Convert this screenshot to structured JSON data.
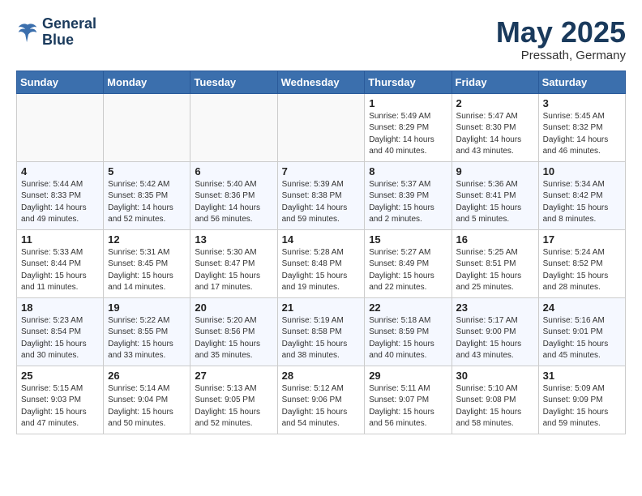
{
  "header": {
    "logo_line1": "General",
    "logo_line2": "Blue",
    "month": "May 2025",
    "location": "Pressath, Germany"
  },
  "weekdays": [
    "Sunday",
    "Monday",
    "Tuesday",
    "Wednesday",
    "Thursday",
    "Friday",
    "Saturday"
  ],
  "weeks": [
    [
      {
        "day": "",
        "info": ""
      },
      {
        "day": "",
        "info": ""
      },
      {
        "day": "",
        "info": ""
      },
      {
        "day": "",
        "info": ""
      },
      {
        "day": "1",
        "info": "Sunrise: 5:49 AM\nSunset: 8:29 PM\nDaylight: 14 hours\nand 40 minutes."
      },
      {
        "day": "2",
        "info": "Sunrise: 5:47 AM\nSunset: 8:30 PM\nDaylight: 14 hours\nand 43 minutes."
      },
      {
        "day": "3",
        "info": "Sunrise: 5:45 AM\nSunset: 8:32 PM\nDaylight: 14 hours\nand 46 minutes."
      }
    ],
    [
      {
        "day": "4",
        "info": "Sunrise: 5:44 AM\nSunset: 8:33 PM\nDaylight: 14 hours\nand 49 minutes."
      },
      {
        "day": "5",
        "info": "Sunrise: 5:42 AM\nSunset: 8:35 PM\nDaylight: 14 hours\nand 52 minutes."
      },
      {
        "day": "6",
        "info": "Sunrise: 5:40 AM\nSunset: 8:36 PM\nDaylight: 14 hours\nand 56 minutes."
      },
      {
        "day": "7",
        "info": "Sunrise: 5:39 AM\nSunset: 8:38 PM\nDaylight: 14 hours\nand 59 minutes."
      },
      {
        "day": "8",
        "info": "Sunrise: 5:37 AM\nSunset: 8:39 PM\nDaylight: 15 hours\nand 2 minutes."
      },
      {
        "day": "9",
        "info": "Sunrise: 5:36 AM\nSunset: 8:41 PM\nDaylight: 15 hours\nand 5 minutes."
      },
      {
        "day": "10",
        "info": "Sunrise: 5:34 AM\nSunset: 8:42 PM\nDaylight: 15 hours\nand 8 minutes."
      }
    ],
    [
      {
        "day": "11",
        "info": "Sunrise: 5:33 AM\nSunset: 8:44 PM\nDaylight: 15 hours\nand 11 minutes."
      },
      {
        "day": "12",
        "info": "Sunrise: 5:31 AM\nSunset: 8:45 PM\nDaylight: 15 hours\nand 14 minutes."
      },
      {
        "day": "13",
        "info": "Sunrise: 5:30 AM\nSunset: 8:47 PM\nDaylight: 15 hours\nand 17 minutes."
      },
      {
        "day": "14",
        "info": "Sunrise: 5:28 AM\nSunset: 8:48 PM\nDaylight: 15 hours\nand 19 minutes."
      },
      {
        "day": "15",
        "info": "Sunrise: 5:27 AM\nSunset: 8:49 PM\nDaylight: 15 hours\nand 22 minutes."
      },
      {
        "day": "16",
        "info": "Sunrise: 5:25 AM\nSunset: 8:51 PM\nDaylight: 15 hours\nand 25 minutes."
      },
      {
        "day": "17",
        "info": "Sunrise: 5:24 AM\nSunset: 8:52 PM\nDaylight: 15 hours\nand 28 minutes."
      }
    ],
    [
      {
        "day": "18",
        "info": "Sunrise: 5:23 AM\nSunset: 8:54 PM\nDaylight: 15 hours\nand 30 minutes."
      },
      {
        "day": "19",
        "info": "Sunrise: 5:22 AM\nSunset: 8:55 PM\nDaylight: 15 hours\nand 33 minutes."
      },
      {
        "day": "20",
        "info": "Sunrise: 5:20 AM\nSunset: 8:56 PM\nDaylight: 15 hours\nand 35 minutes."
      },
      {
        "day": "21",
        "info": "Sunrise: 5:19 AM\nSunset: 8:58 PM\nDaylight: 15 hours\nand 38 minutes."
      },
      {
        "day": "22",
        "info": "Sunrise: 5:18 AM\nSunset: 8:59 PM\nDaylight: 15 hours\nand 40 minutes."
      },
      {
        "day": "23",
        "info": "Sunrise: 5:17 AM\nSunset: 9:00 PM\nDaylight: 15 hours\nand 43 minutes."
      },
      {
        "day": "24",
        "info": "Sunrise: 5:16 AM\nSunset: 9:01 PM\nDaylight: 15 hours\nand 45 minutes."
      }
    ],
    [
      {
        "day": "25",
        "info": "Sunrise: 5:15 AM\nSunset: 9:03 PM\nDaylight: 15 hours\nand 47 minutes."
      },
      {
        "day": "26",
        "info": "Sunrise: 5:14 AM\nSunset: 9:04 PM\nDaylight: 15 hours\nand 50 minutes."
      },
      {
        "day": "27",
        "info": "Sunrise: 5:13 AM\nSunset: 9:05 PM\nDaylight: 15 hours\nand 52 minutes."
      },
      {
        "day": "28",
        "info": "Sunrise: 5:12 AM\nSunset: 9:06 PM\nDaylight: 15 hours\nand 54 minutes."
      },
      {
        "day": "29",
        "info": "Sunrise: 5:11 AM\nSunset: 9:07 PM\nDaylight: 15 hours\nand 56 minutes."
      },
      {
        "day": "30",
        "info": "Sunrise: 5:10 AM\nSunset: 9:08 PM\nDaylight: 15 hours\nand 58 minutes."
      },
      {
        "day": "31",
        "info": "Sunrise: 5:09 AM\nSunset: 9:09 PM\nDaylight: 15 hours\nand 59 minutes."
      }
    ]
  ]
}
